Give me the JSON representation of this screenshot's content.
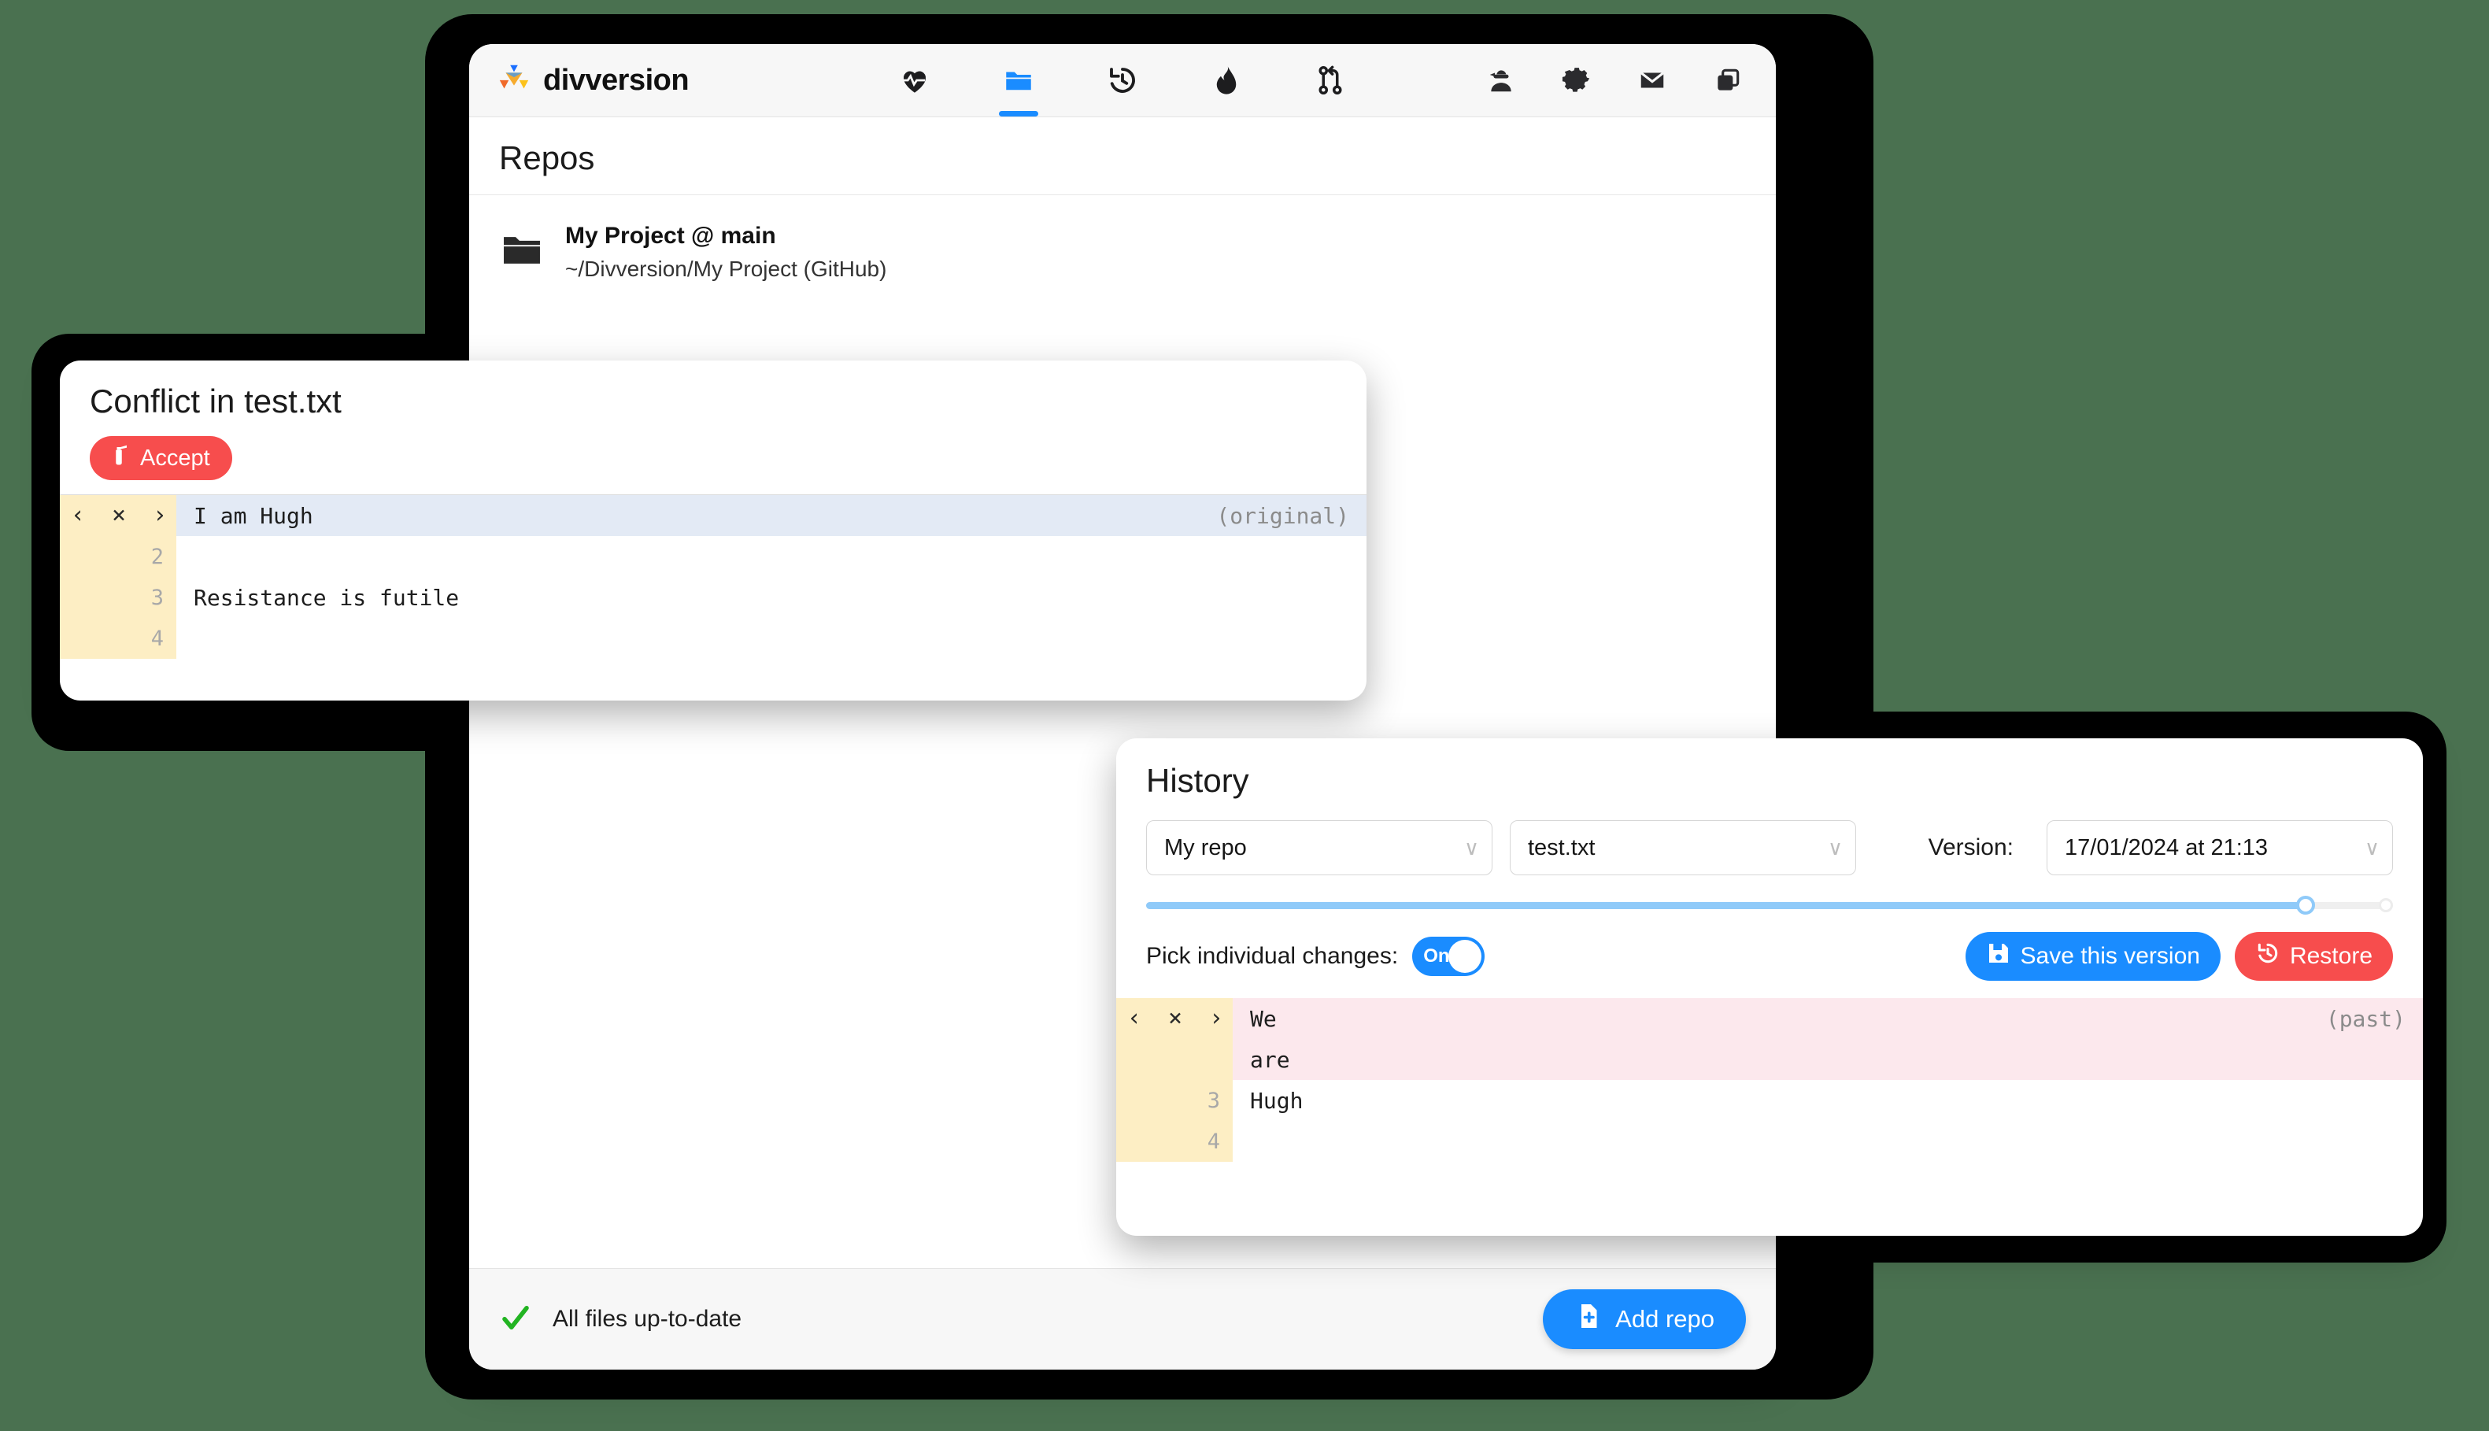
{
  "background_color": "#4a7150",
  "app": {
    "brand_name": "divversion",
    "toolbar": {
      "center_items": [
        {
          "name": "health-icon",
          "label": "Health"
        },
        {
          "name": "folder-icon",
          "label": "Repos",
          "active": true
        },
        {
          "name": "history-icon",
          "label": "History"
        },
        {
          "name": "flame-icon",
          "label": "Conflicts"
        },
        {
          "name": "pull-request-icon",
          "label": "Pull requests"
        }
      ],
      "right_items": [
        {
          "name": "ninja-user-icon",
          "label": "Account"
        },
        {
          "name": "gear-icon",
          "label": "Settings"
        },
        {
          "name": "mail-icon",
          "label": "Messages"
        },
        {
          "name": "windows-icon",
          "label": "Windows"
        }
      ]
    }
  },
  "repos_page": {
    "title": "Repos",
    "items": [
      {
        "name": "My Project @ main",
        "path": "~/Divversion/My Project (GitHub)"
      }
    ]
  },
  "footer": {
    "status_text": "All files up-to-date",
    "status_icon": "check-icon",
    "status_color": "#22b422",
    "add_repo_label": "Add repo",
    "add_repo_color": "#1a8cff"
  },
  "conflict_window": {
    "title": "Conflict in test.txt",
    "accept_label": "Accept",
    "accept_color": "#f74d4d",
    "accept_icon": "fire-extinguisher-icon",
    "diff": {
      "side_tag": "(original)",
      "nav": {
        "prev": "‹",
        "reject": "×",
        "next": "›"
      },
      "rows": [
        {
          "line": "",
          "text": "I am Hugh",
          "highlight": "blue",
          "nav": true,
          "tag": "(original)"
        },
        {
          "line": "2",
          "text": "",
          "highlight": "none",
          "nav": false
        },
        {
          "line": "3",
          "text": "Resistance is futile",
          "highlight": "none",
          "nav": false
        },
        {
          "line": "4",
          "text": "",
          "highlight": "none",
          "nav": false
        }
      ]
    }
  },
  "history_window": {
    "title": "History",
    "repo_select": {
      "value": "My repo",
      "chevron": "∨"
    },
    "file_select": {
      "value": "test.txt",
      "chevron": "∨"
    },
    "version_label": "Version:",
    "version_select": {
      "value": "17/01/2024 at 21:13",
      "chevron": "∨"
    },
    "slider": {
      "percent": 93
    },
    "pick_changes_label": "Pick individual changes:",
    "toggle_state": "On",
    "save_label": "Save this version",
    "save_icon": "floppy-disk-icon",
    "save_color": "#1a8cff",
    "restore_label": "Restore",
    "restore_icon": "clock-rewind-icon",
    "restore_color": "#f74d4d",
    "diff": {
      "side_tag": "(past)",
      "nav": {
        "prev": "‹",
        "reject": "×",
        "next": "›"
      },
      "rows": [
        {
          "line": "",
          "text": "We",
          "highlight": "pink",
          "nav": true,
          "tag": "(past)"
        },
        {
          "line": "",
          "text": "are",
          "highlight": "pink",
          "nav": false
        },
        {
          "line": "3",
          "text": "Hugh",
          "highlight": "none",
          "nav": false
        },
        {
          "line": "4",
          "text": "",
          "highlight": "none",
          "nav": false
        }
      ]
    }
  }
}
